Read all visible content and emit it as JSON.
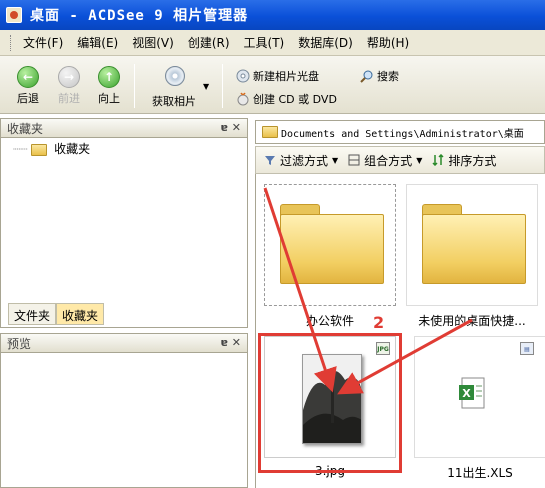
{
  "window": {
    "title": "桌面 - ACDSee 9 相片管理器"
  },
  "menu": [
    "文件(F)",
    "编辑(E)",
    "视图(V)",
    "创建(R)",
    "工具(T)",
    "数据库(D)",
    "帮助(H)"
  ],
  "toolbar": {
    "back": "后退",
    "forward": "前进",
    "up": "向上",
    "acquire": "获取相片",
    "new_cd": "新建相片光盘",
    "search": "搜索",
    "create_cd": "创建 CD 或 DVD"
  },
  "favorites_panel": {
    "title": "收藏夹",
    "tree_item": "收藏夹",
    "tabs": [
      "文件夹",
      "收藏夹"
    ]
  },
  "preview_panel": {
    "title": "预览"
  },
  "path": "Documents and Settings\\Administrator\\桌面",
  "filterbar": {
    "filter": "过滤方式",
    "group": "组合方式",
    "sort": "排序方式"
  },
  "items": [
    {
      "name": "办公软件",
      "kind": "folder"
    },
    {
      "name": "未使用的桌面快捷...",
      "kind": "folder"
    },
    {
      "name": "3.jpg",
      "kind": "image",
      "badge": "JPG"
    },
    {
      "name": "11出生.XLS",
      "kind": "xls"
    }
  ],
  "annotation": {
    "label": "2",
    "color": "#e03c34"
  },
  "colors": {
    "titlebar": "#0a50d8",
    "menubar": "#ece9d8",
    "selection_tab": "#ffe9a8"
  }
}
